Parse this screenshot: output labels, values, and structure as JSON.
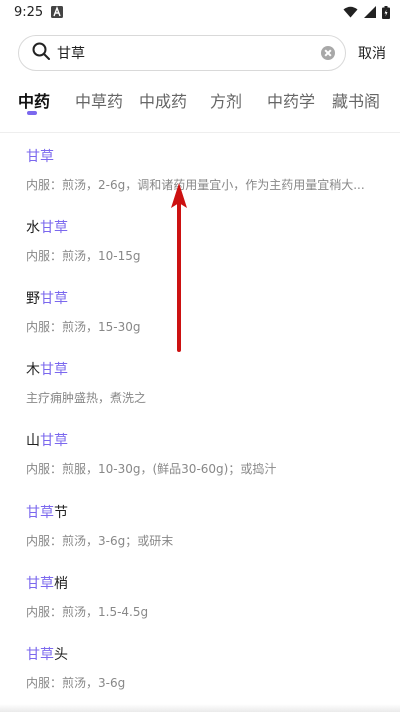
{
  "status_bar": {
    "time": "9:25"
  },
  "search": {
    "value": "甘草",
    "cancel_label": "取消"
  },
  "tabs": [
    {
      "label": "中药",
      "active": true
    },
    {
      "label": "中草药"
    },
    {
      "label": "中成药"
    },
    {
      "label": "方剂"
    },
    {
      "label": "中药学"
    },
    {
      "label": "藏书阁"
    }
  ],
  "results": [
    {
      "prefix": "",
      "highlight": "甘草",
      "suffix": "",
      "desc": "内服：煎汤，2-6g，调和诸药用量宜小，作为主药用量宜稍大..."
    },
    {
      "prefix": "水",
      "highlight": "甘草",
      "suffix": "",
      "desc": "内服：煎汤，10-15g"
    },
    {
      "prefix": "野",
      "highlight": "甘草",
      "suffix": "",
      "desc": "内服：煎汤，15-30g"
    },
    {
      "prefix": "木",
      "highlight": "甘草",
      "suffix": "",
      "desc": "主疗痈肿盛热，煮洗之"
    },
    {
      "prefix": "山",
      "highlight": "甘草",
      "suffix": "",
      "desc": "内服：煎服，10-30g，(鲜品30-60g)；或捣汁"
    },
    {
      "prefix": "",
      "highlight": "甘草",
      "suffix": "节",
      "desc": "内服：煎汤，3-6g；或研末"
    },
    {
      "prefix": "",
      "highlight": "甘草",
      "suffix": "梢",
      "desc": "内服：煎汤，1.5-4.5g"
    },
    {
      "prefix": "",
      "highlight": "甘草",
      "suffix": "头",
      "desc": "内服：煎汤，3-6g"
    }
  ],
  "colors": {
    "accent": "#7b68ee",
    "arrow": "#cc1111"
  }
}
